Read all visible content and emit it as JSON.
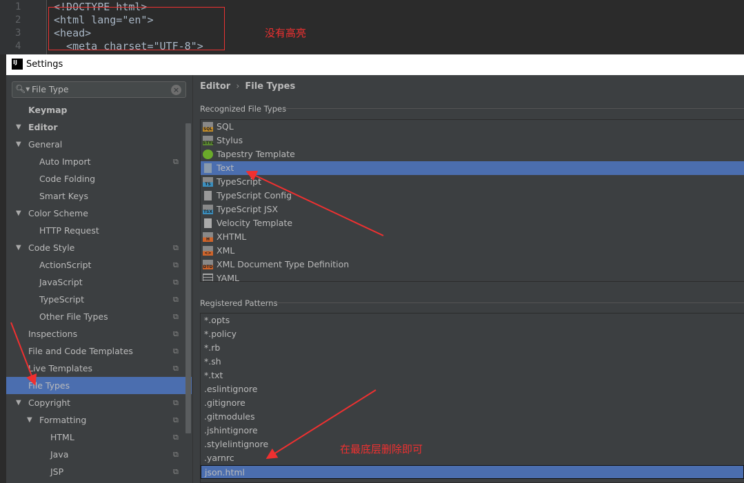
{
  "editor": {
    "line_numbers": [
      "1",
      "2",
      "3",
      "4"
    ],
    "lines": [
      "<!DOCTYPE html>",
      "<html lang=\"en\">",
      "<head>",
      "  <meta charset=\"UTF-8\">"
    ]
  },
  "annotations": {
    "no_highlight": "没有高亮",
    "delete_at_bottom": "在最底层删除即可",
    "color": "#f03030"
  },
  "window": {
    "logo": "IJ",
    "title": "Settings"
  },
  "search": {
    "value": "File Type"
  },
  "tree": [
    {
      "label": "Keymap",
      "level": 0,
      "bold": true
    },
    {
      "label": "Editor",
      "level": 0,
      "bold": true,
      "expanded": true
    },
    {
      "label": "General",
      "level": 1,
      "expanded": true
    },
    {
      "label": "Auto Import",
      "level": 2,
      "copy": true
    },
    {
      "label": "Code Folding",
      "level": 2
    },
    {
      "label": "Smart Keys",
      "level": 2
    },
    {
      "label": "Color Scheme",
      "level": 1,
      "expanded": true
    },
    {
      "label": "HTTP Request",
      "level": 2
    },
    {
      "label": "Code Style",
      "level": 1,
      "expanded": true,
      "copy": true
    },
    {
      "label": "ActionScript",
      "level": 2,
      "copy": true
    },
    {
      "label": "JavaScript",
      "level": 2,
      "copy": true
    },
    {
      "label": "TypeScript",
      "level": 2,
      "copy": true
    },
    {
      "label": "Other File Types",
      "level": 2,
      "copy": true
    },
    {
      "label": "Inspections",
      "level": 1,
      "copy": true
    },
    {
      "label": "File and Code Templates",
      "level": 1,
      "copy": true
    },
    {
      "label": "Live Templates",
      "level": 1,
      "copy": true
    },
    {
      "label": "File Types",
      "level": 1,
      "selected": true
    },
    {
      "label": "Copyright",
      "level": 1,
      "expanded": true,
      "copy": true
    },
    {
      "label": "Formatting",
      "level": 2,
      "expanded": true,
      "copy": true
    },
    {
      "label": "HTML",
      "level": 3,
      "copy": true
    },
    {
      "label": "Java",
      "level": 3,
      "copy": true
    },
    {
      "label": "JSP",
      "level": 3,
      "copy": true
    }
  ],
  "breadcrumb": {
    "parent": "Editor",
    "separator": "›",
    "current": "File Types"
  },
  "recognized": {
    "title": "Recognized File Types",
    "items": [
      {
        "label": "SQL",
        "icon": "SQL",
        "color": "#c9902a"
      },
      {
        "label": "Stylus",
        "icon": "STYL",
        "color": "#5a8a2e"
      },
      {
        "label": "Tapestry Template",
        "icon": "tapestry",
        "color": "#6aaa2a"
      },
      {
        "label": "Text",
        "icon": "text",
        "color": "#8a9aac",
        "selected": true
      },
      {
        "label": "TypeScript",
        "icon": "TS",
        "color": "#3a8fbf"
      },
      {
        "label": "TypeScript Config",
        "icon": "config",
        "color": "#999999"
      },
      {
        "label": "TypeScript JSX",
        "icon": "TSX",
        "color": "#3a8fbf"
      },
      {
        "label": "Velocity Template",
        "icon": "velocity",
        "color": "#aaaaaa"
      },
      {
        "label": "XHTML",
        "icon": "H",
        "color": "#d0642a"
      },
      {
        "label": "XML",
        "icon": "<>",
        "color": "#d0642a"
      },
      {
        "label": "XML Document Type Definition",
        "icon": "DTD",
        "color": "#d0642a"
      },
      {
        "label": "YAML",
        "icon": "table",
        "color": "#aaaaaa"
      }
    ]
  },
  "patterns": {
    "title": "Registered Patterns",
    "items": [
      "*.opts",
      "*.policy",
      "*.rb",
      "*.sh",
      "*.txt",
      ".eslintignore",
      ".gitignore",
      ".gitmodules",
      ".jshintignore",
      ".stylelintignore",
      ".yarnrc",
      "json.html"
    ],
    "selected": "json.html"
  },
  "colors": {
    "selection": "#4b6eaf",
    "panel": "#3c3f41"
  }
}
